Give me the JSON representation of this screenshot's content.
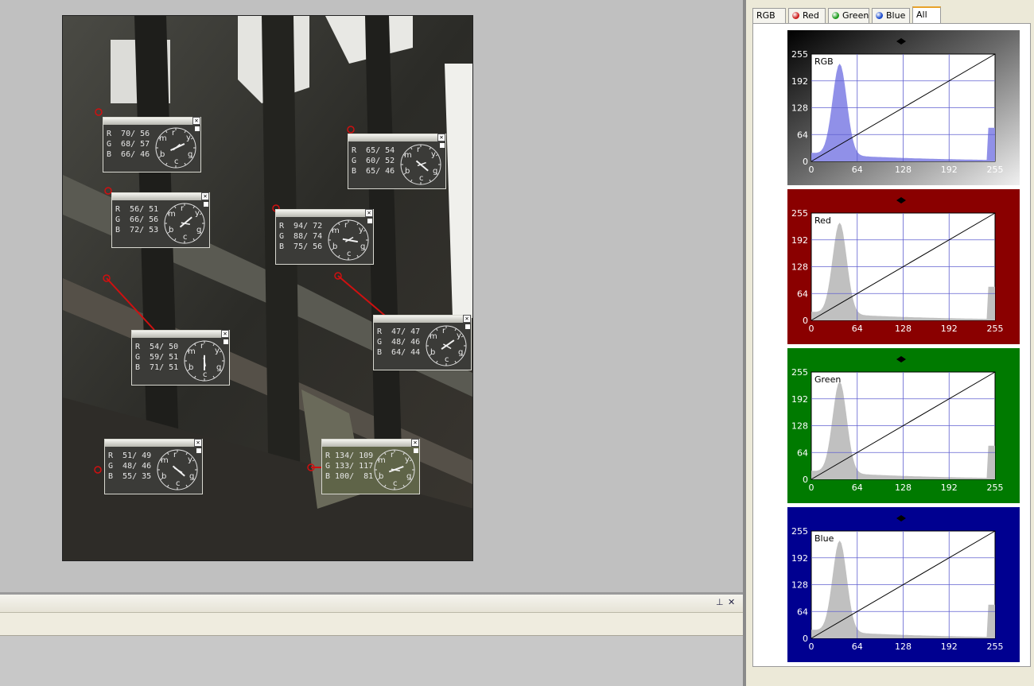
{
  "probes": [
    {
      "r": "R  70/ 56",
      "g": "G  68/ 57",
      "b": "B  66/ 46"
    },
    {
      "r": "R  65/ 54",
      "g": "G  60/ 52",
      "b": "B  65/ 46"
    },
    {
      "r": "R  56/ 51",
      "g": "G  66/ 56",
      "b": "B  72/ 53"
    },
    {
      "r": "R  94/ 72",
      "g": "G  88/ 74",
      "b": "B  75/ 56"
    },
    {
      "r": "R  47/ 47",
      "g": "G  48/ 46",
      "b": "B  64/ 44"
    },
    {
      "r": "R  54/ 50",
      "g": "G  59/ 51",
      "b": "B  71/ 51"
    },
    {
      "r": "R  51/ 49",
      "g": "G  48/ 46",
      "b": "B  55/ 35"
    },
    {
      "r": "R 134/ 109",
      "g": "G 133/ 117",
      "b": "B 100/  81"
    }
  ],
  "dial_letters": {
    "r": "r",
    "y": "y",
    "g": "g",
    "c": "c",
    "b": "b",
    "m": "m"
  },
  "close_glyph": "✕",
  "bottom_panel": {
    "pin": "⊥",
    "close": "✕"
  },
  "tabs": [
    {
      "label": "RGB",
      "dot": ""
    },
    {
      "label": "Red",
      "dot": "#cc1a1a"
    },
    {
      "label": "Green",
      "dot": "#1a9a1a"
    },
    {
      "label": "Blue",
      "dot": "#1a4acc"
    },
    {
      "label": "All",
      "dot": ""
    }
  ],
  "selected_tab": "All",
  "curves": [
    {
      "name": "RGB",
      "bg": "#6a6a6a",
      "y_ticks": [
        "255",
        "192",
        "128",
        "64",
        "0"
      ],
      "x_ticks": [
        "0",
        "64",
        "128",
        "192",
        "255"
      ]
    },
    {
      "name": "Red",
      "bg": "#8a0000",
      "y_ticks": [
        "255",
        "192",
        "128",
        "64",
        "0"
      ],
      "x_ticks": [
        "0",
        "64",
        "128",
        "192",
        "255"
      ]
    },
    {
      "name": "Green",
      "bg": "#007a00",
      "y_ticks": [
        "255",
        "192",
        "128",
        "64",
        "0"
      ],
      "x_ticks": [
        "0",
        "64",
        "128",
        "192",
        "255"
      ]
    },
    {
      "name": "Blue",
      "bg": "#000090",
      "y_ticks": [
        "255",
        "192",
        "128",
        "64",
        "0"
      ],
      "x_ticks": [
        "0",
        "64",
        "128",
        "192",
        "255"
      ]
    }
  ]
}
